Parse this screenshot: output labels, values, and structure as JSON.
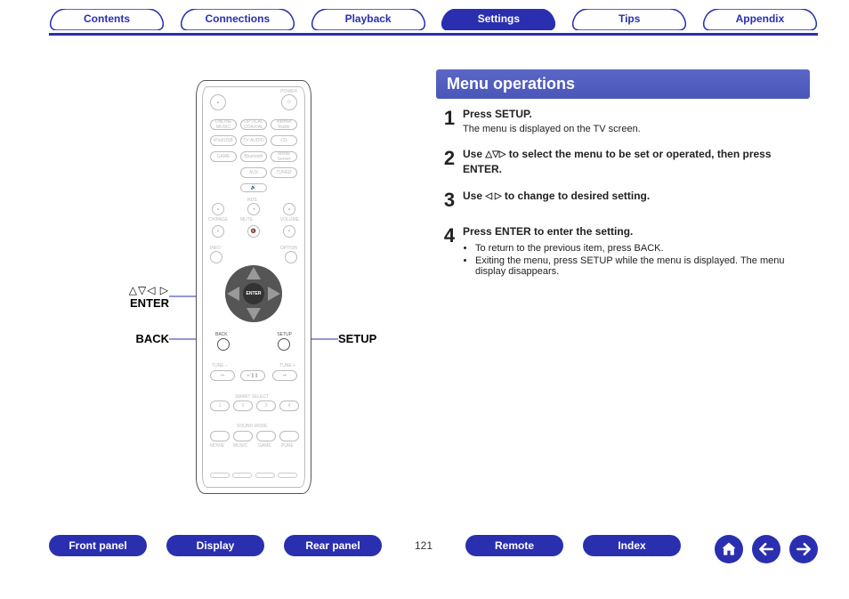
{
  "tabs": {
    "contents": "Contents",
    "connections": "Connections",
    "playback": "Playback",
    "settings": "Settings",
    "tips": "Tips",
    "appendix": "Appendix",
    "active": "settings"
  },
  "remote_callouts": {
    "arrows": "△▽◁ ▷",
    "enter": "ENTER",
    "back": "BACK",
    "setup": "SETUP"
  },
  "section_title": "Menu operations",
  "steps": [
    {
      "num": "1",
      "title": "Press SETUP.",
      "sub": "The menu is displayed on the TV screen."
    },
    {
      "num": "2",
      "title_parts": [
        "Use ",
        "△▽▷",
        " to select the menu to be set or operated, then press ENTER."
      ]
    },
    {
      "num": "3",
      "title_parts": [
        "Use ",
        "◁ ▷",
        " to change to desired setting."
      ]
    },
    {
      "num": "4",
      "title": "Press ENTER to enter the setting.",
      "bullets": [
        "To return to the previous item, press BACK.",
        "Exiting the menu, press SETUP while the menu is displayed. The menu display disappears."
      ]
    }
  ],
  "bottom": {
    "front_panel": "Front panel",
    "display": "Display",
    "rear_panel": "Rear panel",
    "page": "121",
    "remote": "Remote",
    "index": "Index"
  },
  "remote_btn_labels": {
    "power": "POWER",
    "onlinemusic": "ONLINE MUSIC",
    "opticalcoaxial": "OPTICAL COAXIAL",
    "interradio": "Internet Radio",
    "ipodusb": "iPod/USB",
    "tvaudio": "TV AUDIO",
    "cd": "CD",
    "game": "GAME",
    "bluetooth": "Bluetooth",
    "mediaserver": "Media Server",
    "aux": "AUX",
    "tuner": "TUNER",
    "rds": "RDS",
    "chpage": "CH/PAGE",
    "mute": "MUTE",
    "volume": "VOLUME",
    "info": "INFO",
    "option": "OPTION",
    "enter": "ENTER",
    "back_sm": "BACK",
    "setup_sm": "SETUP",
    "tune_minus": "TUNE –",
    "tune_plus": "TUNE +",
    "smartselect": "SMART SELECT",
    "soundmode": "SOUND MODE",
    "movie": "MOVIE",
    "music": "MUSIC",
    "game2": "GAME",
    "pure": "PURE"
  }
}
